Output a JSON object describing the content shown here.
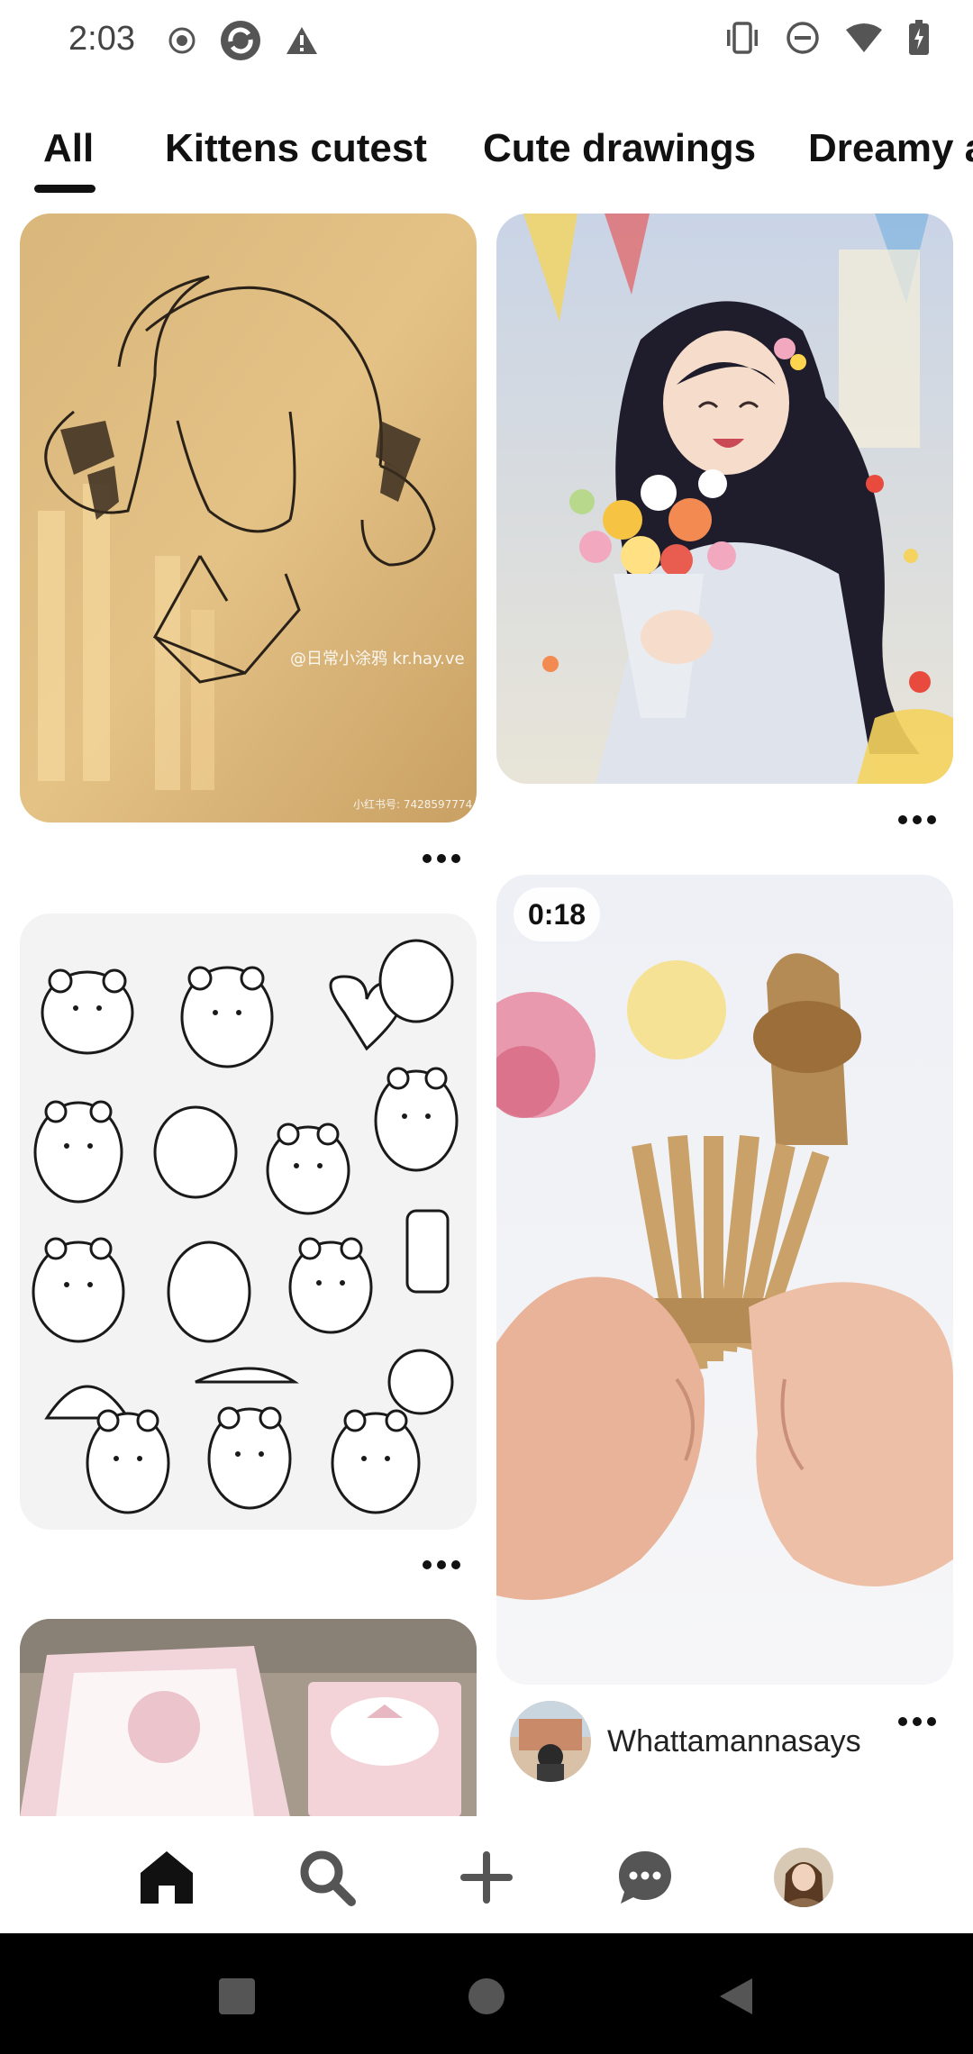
{
  "status_bar": {
    "time": "2:03",
    "left_icons": [
      "record-icon",
      "sync-app-icon",
      "warning-icon"
    ],
    "right_icons": [
      "vibrate-icon",
      "do-not-disturb-icon",
      "wifi-icon",
      "battery-icon"
    ]
  },
  "tabs": [
    {
      "label": "All",
      "selected": true
    },
    {
      "label": "Kittens cutest",
      "selected": false
    },
    {
      "label": "Cute drawings",
      "selected": false
    },
    {
      "label": "Dreamy a",
      "selected": false
    }
  ],
  "pins": [
    {
      "id": "girl-sketch",
      "overlay_text": "@日常小涂鸦 kr.hay.ve",
      "watermark": "小红书号: 7428597774"
    },
    {
      "id": "anime-girl-flowers"
    },
    {
      "id": "bear-stickers"
    },
    {
      "id": "straw-basket-video",
      "duration": "0:18",
      "author": "Whattamannasays"
    },
    {
      "id": "birthday-card"
    }
  ],
  "bottom_nav": [
    "home-icon",
    "search-icon",
    "create-icon",
    "messages-icon",
    "profile-avatar"
  ],
  "colors": {
    "accent": "#111111",
    "background": "#ffffff",
    "system_nav": "#000000"
  }
}
